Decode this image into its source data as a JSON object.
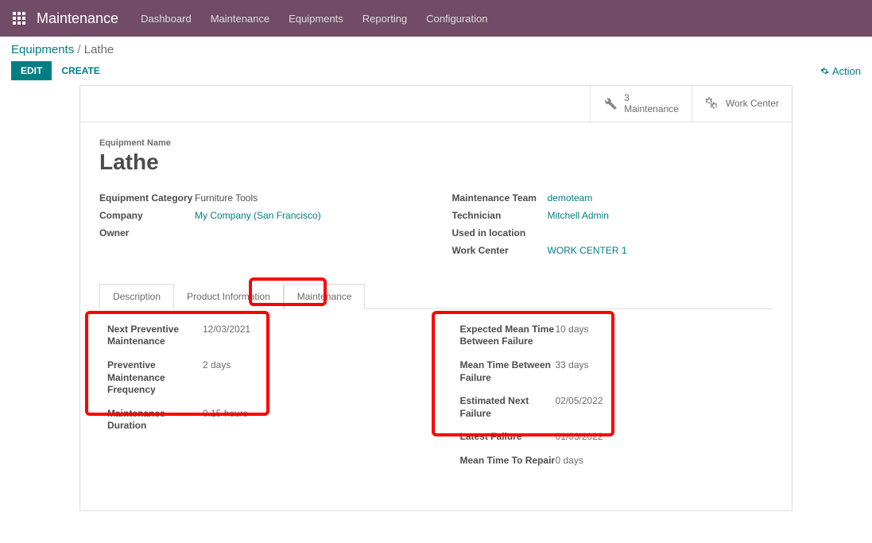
{
  "topbar": {
    "app_title": "Maintenance",
    "nav": [
      "Dashboard",
      "Maintenance",
      "Equipments",
      "Reporting",
      "Configuration"
    ]
  },
  "breadcrumb": {
    "parent": "Equipments",
    "sep": "/",
    "current": "Lathe"
  },
  "buttons": {
    "edit": "EDIT",
    "create": "CREATE",
    "action": "Action"
  },
  "stat_buttons": {
    "maintenance": {
      "count": "3",
      "label": "Maintenance"
    },
    "workcenter": {
      "label": "Work Center"
    }
  },
  "form": {
    "name_label": "Equipment Name",
    "name": "Lathe",
    "left": {
      "category_label": "Equipment Category",
      "category": "Furniture Tools",
      "company_label": "Company",
      "company": "My Company (San Francisco)",
      "owner_label": "Owner",
      "owner": ""
    },
    "right": {
      "team_label": "Maintenance Team",
      "team": "demoteam",
      "tech_label": "Technician",
      "tech": "Mitchell Admin",
      "used_label": "Used in location",
      "used": "",
      "wc_label": "Work Center",
      "wc": "WORK CENTER 1"
    }
  },
  "tabs": {
    "t1": "Description",
    "t2": "Product Information",
    "t3": "Maintenance"
  },
  "maint_left": {
    "next_label": "Next Preventive Maintenance",
    "next": "12/03/2021",
    "freq_label": "Preventive Maintenance Frequency",
    "freq": "2  days",
    "dur_label": "Maintenance Duration",
    "dur": "0.15  hours"
  },
  "maint_right": {
    "emtbf_label": "Expected Mean Time Between Failure",
    "emtbf": "10  days",
    "mtbf_label": "Mean Time Between Failure",
    "mtbf": "33  days",
    "enf_label": "Estimated Next Failure",
    "enf": "02/05/2022",
    "lf_label": "Latest Failure",
    "lf": "01/03/2022",
    "mttr_label": "Mean Time To Repair",
    "mttr": "0  days"
  }
}
